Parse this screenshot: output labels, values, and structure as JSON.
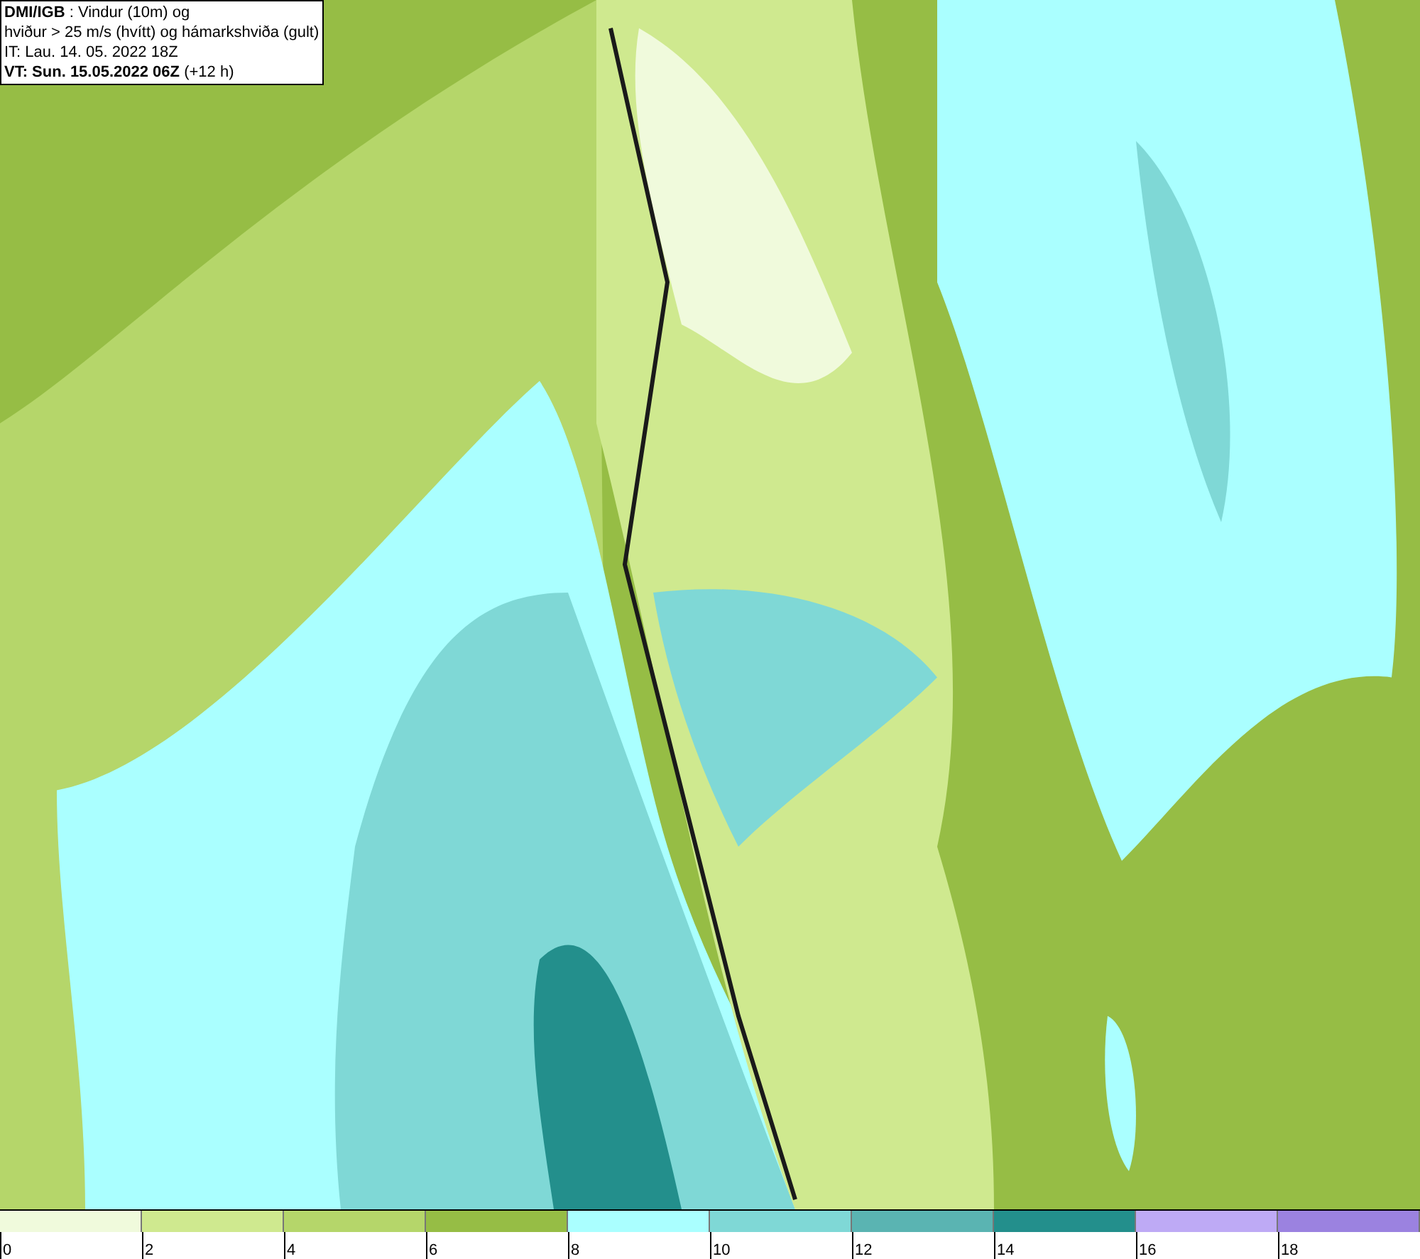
{
  "header": {
    "lines": [
      "**DMI/IGB** : Vindur (10m) og",
      "hviður > 25 m/s (hvítt) og hámarkshviða (gult)",
      "IT: Lau. 14. 05. 2022 18Z",
      "**VT: Sun. 15.05.2022 06Z** (+12 h)"
    ]
  },
  "legend": {
    "bins": [
      {
        "label": "0",
        "color": "#f0fadc"
      },
      {
        "label": "2",
        "color": "#cfe98f"
      },
      {
        "label": "4",
        "color": "#b5d66a"
      },
      {
        "label": "6",
        "color": "#96bd45"
      },
      {
        "label": "8",
        "color": "#aaffff"
      },
      {
        "label": "10",
        "color": "#7fd8d6"
      },
      {
        "label": "12",
        "color": "#5ab4b2"
      },
      {
        "label": "14",
        "color": "#238f8c"
      },
      {
        "label": "16",
        "color": "#beaaf5"
      },
      {
        "label": "18",
        "color": "#9b82e0"
      }
    ]
  }
}
